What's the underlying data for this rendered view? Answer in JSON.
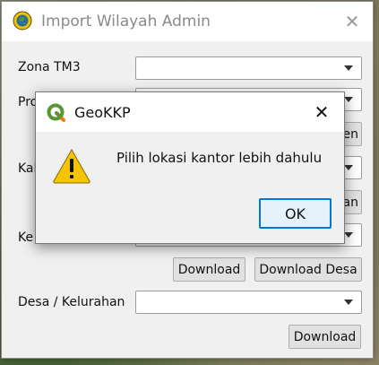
{
  "window": {
    "title": "Import Wilayah Admin",
    "close_glyph": "✕",
    "icon": "globe-app-icon"
  },
  "form": {
    "zona_label": "Zona TM3",
    "prov_label": "Pro",
    "kab_label": "Kal",
    "kec_label": "Ke",
    "desa_label": "Desa / Kelurahan",
    "prov_download_partial": "en",
    "kab_download_partial": "an",
    "download_label": "Download",
    "download_desa_label": "Download Desa",
    "desa_download_label": "Download"
  },
  "dialog": {
    "title": "GeoKKP",
    "close_glyph": "✕",
    "message": "Pilih lokasi kantor lebih dahulu",
    "ok_label": "OK",
    "icon": "qgis-icon",
    "warning_icon": "warning-icon"
  },
  "colors": {
    "accent": "#0078d7",
    "warning_yellow": "#f5c400",
    "qgis_green": "#589632"
  }
}
